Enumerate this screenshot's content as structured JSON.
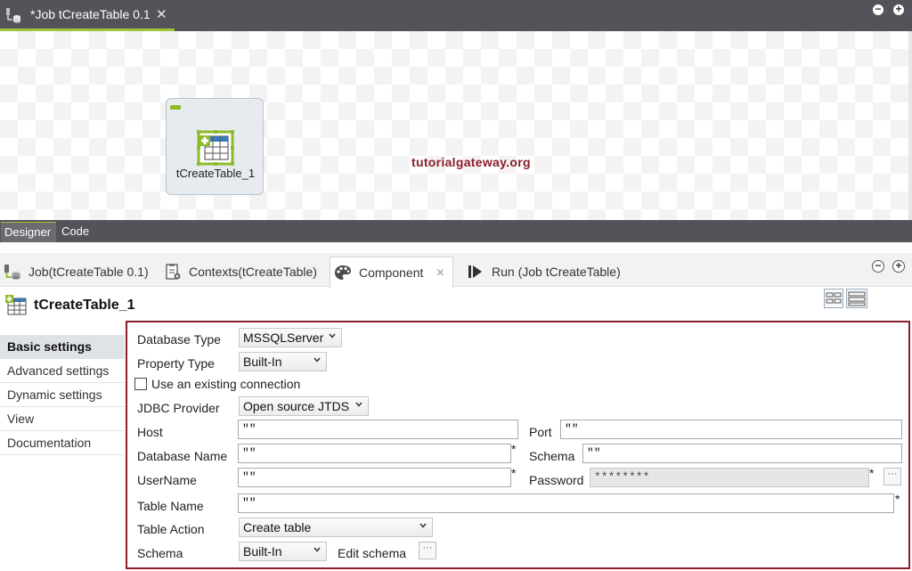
{
  "editor": {
    "tab_title": "*Job tCreateTable 0.1",
    "tab_close": "✕",
    "component_label": "tCreateTable_1",
    "watermark": "tutorialgateway.org",
    "view_tabs": [
      "Designer",
      "Code"
    ],
    "window_minimize": "−",
    "window_maximize": "+"
  },
  "panel": {
    "tabs": [
      {
        "label": "Job(tCreateTable 0.1)",
        "icon": "job-icon"
      },
      {
        "label": "Contexts(tCreateTable)",
        "icon": "contexts-icon"
      },
      {
        "label": "Component",
        "icon": "palette-icon",
        "active": true
      },
      {
        "label": "Run (Job tCreateTable)",
        "icon": "run-icon"
      }
    ],
    "component_close": "✕",
    "header_title": "tCreateTable_1"
  },
  "nav": {
    "items": [
      "Basic settings",
      "Advanced settings",
      "Dynamic settings",
      "View",
      "Documentation"
    ],
    "active": "Basic settings"
  },
  "form": {
    "database_type": {
      "label": "Database Type",
      "value": "MSSQLServer"
    },
    "property_type": {
      "label": "Property Type",
      "value": "Built-In"
    },
    "use_existing": {
      "label": "Use an existing connection",
      "checked": false
    },
    "jdbc_provider": {
      "label": "JDBC Provider",
      "value": "Open source JTDS"
    },
    "host": {
      "label": "Host",
      "value": "\"\""
    },
    "port": {
      "label": "Port",
      "value": "\"\""
    },
    "database_name": {
      "label": "Database Name",
      "value": "\"\""
    },
    "schema": {
      "label": "Schema",
      "value": "\"\""
    },
    "username": {
      "label": "UserName",
      "value": "\"\""
    },
    "password": {
      "label": "Password",
      "value": "********"
    },
    "table_name": {
      "label": "Table Name",
      "value": "\"\""
    },
    "table_action": {
      "label": "Table Action",
      "value": "Create table"
    },
    "schema_type": {
      "label": "Schema",
      "value": "Built-In"
    },
    "edit_schema": {
      "label": "Edit schema"
    },
    "required_mark": "*",
    "ellipsis": "···"
  },
  "colors": {
    "accent_green": "#9fc53a",
    "highlight_frame": "#8b1d2c",
    "tabbar": "#535359"
  }
}
